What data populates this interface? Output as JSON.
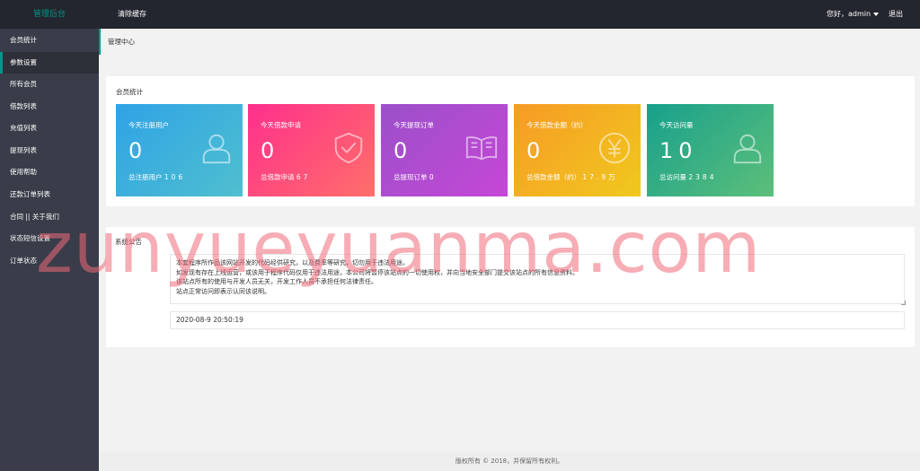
{
  "header": {
    "logo": "管理后台",
    "clear_cache": "清除缓存",
    "greeting": "您好，admin",
    "logout": "退出"
  },
  "sidebar": {
    "items": [
      {
        "label": "会员统计"
      },
      {
        "label": "参数设置"
      },
      {
        "label": "所有会员"
      },
      {
        "label": "借款列表"
      },
      {
        "label": "充值列表"
      },
      {
        "label": "提现列表"
      },
      {
        "label": "使用帮助"
      },
      {
        "label": "还款订单列表"
      },
      {
        "label": "合同 || 关于我们"
      },
      {
        "label": "状态短信设置"
      },
      {
        "label": "订单状态"
      }
    ],
    "active_index": 1
  },
  "tab": {
    "title": "管理中心"
  },
  "stats": {
    "title": "会员统计",
    "cards": [
      {
        "label": "今天注册用户",
        "value": "0",
        "foot_label": "总注册用户",
        "foot_value": "106",
        "icon": "user-icon",
        "gradient": [
          "#2fa3e6",
          "#4fbfcf"
        ]
      },
      {
        "label": "今天借款申请",
        "value": "0",
        "foot_label": "总借款申请",
        "foot_value": "67",
        "icon": "shield-check-icon",
        "gradient": [
          "#ff2f8c",
          "#ff6f6a"
        ]
      },
      {
        "label": "今天提现订单",
        "value": "0",
        "foot_label": "总提现订单",
        "foot_value": "0",
        "icon": "book-icon",
        "gradient": [
          "#9b50c9",
          "#c547d6"
        ]
      },
      {
        "label": "今天借款金额（约）",
        "value": "0",
        "foot_label": "总借款金额（约）",
        "foot_value": "17.9万",
        "icon": "yen-icon",
        "gradient": [
          "#f79a26",
          "#f0c91e"
        ]
      },
      {
        "label": "今天访问量",
        "value": "10",
        "foot_label": "总访问量",
        "foot_value": "2384",
        "icon": "user-icon",
        "gradient": [
          "#17a08c",
          "#5dbf7a"
        ]
      }
    ]
  },
  "notice": {
    "label": "系统公告",
    "text": "本套程序所作品该网站开发的代码经供研究，以及费率等研究，切勿用于违法用途。\n如发现有存在上线运营，或该用于程序代码仅用于违法用途，本公司将暂停该站点的一切使用权，并向当地安全部门提交该站点的所有信息资料。\n该站点所有的使用与开发人员无关，开发工作人员不承担任何法律责任。\n站点正常访问即表示认同该说明。",
    "date": "2020-08-9 20:50:19"
  },
  "footer": {
    "text": "版权所有 © 2018，并保留所有权利。"
  },
  "watermark": {
    "text": "zunyueyuanma.com"
  }
}
